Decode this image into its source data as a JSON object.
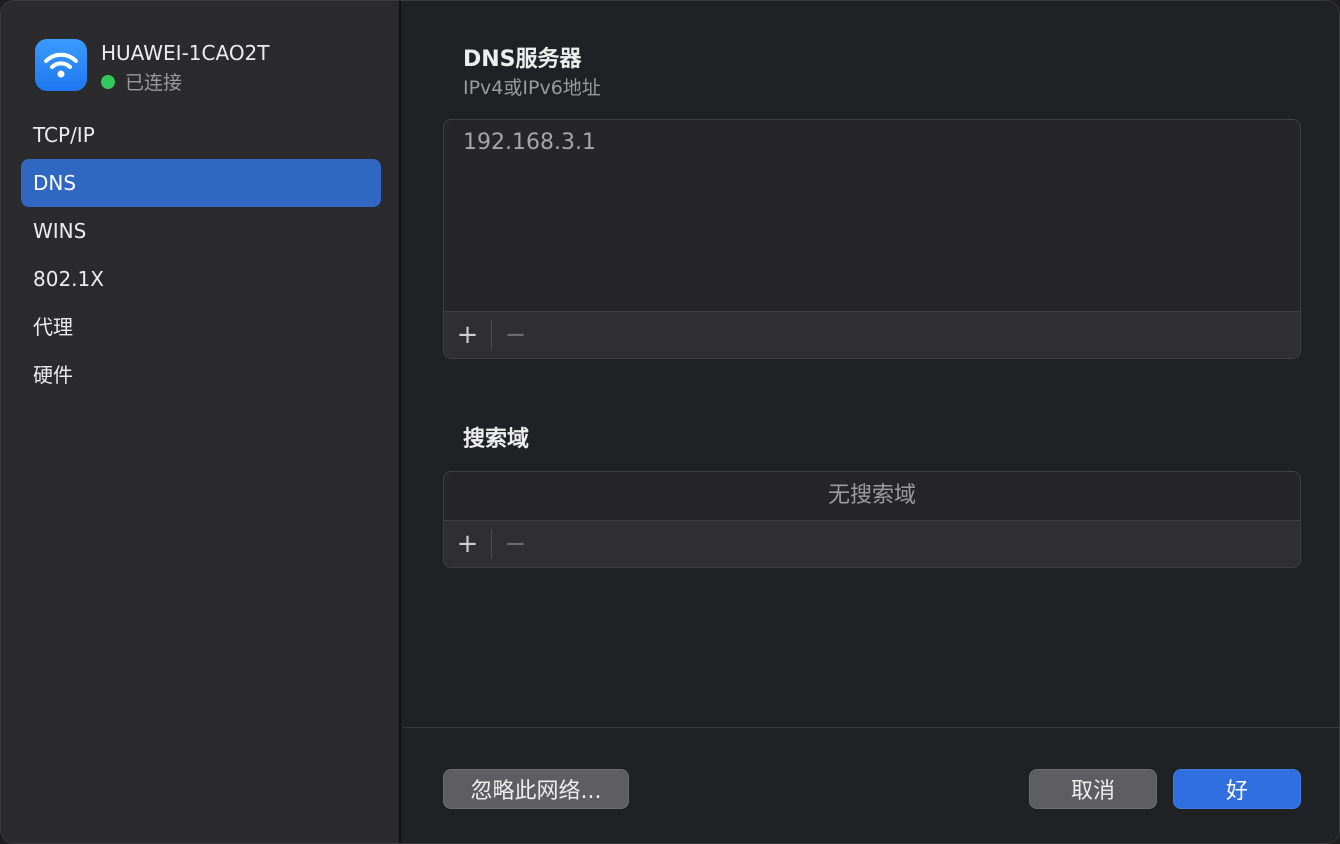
{
  "network": {
    "name": "HUAWEI-1CAO2T",
    "status": "已连接",
    "status_color": "#34c759",
    "icon": "wifi-icon"
  },
  "sidebar": {
    "items": [
      {
        "label": "TCP/IP",
        "active": false
      },
      {
        "label": "DNS",
        "active": true
      },
      {
        "label": "WINS",
        "active": false
      },
      {
        "label": "802.1X",
        "active": false
      },
      {
        "label": "代理",
        "active": false
      },
      {
        "label": "硬件",
        "active": false
      }
    ],
    "active_color": "#2f67c3"
  },
  "dns": {
    "title": "DNS服务器",
    "subtitle": "IPv4或IPv6地址",
    "servers": [
      "192.168.3.1"
    ],
    "add_label": "+",
    "remove_label": "−"
  },
  "search_domains": {
    "title": "搜索域",
    "empty_text": "无搜索域",
    "add_label": "+",
    "remove_label": "−"
  },
  "footer": {
    "forget_label": "忽略此网络...",
    "cancel_label": "取消",
    "ok_label": "好",
    "accent": "#2f6fe0"
  }
}
